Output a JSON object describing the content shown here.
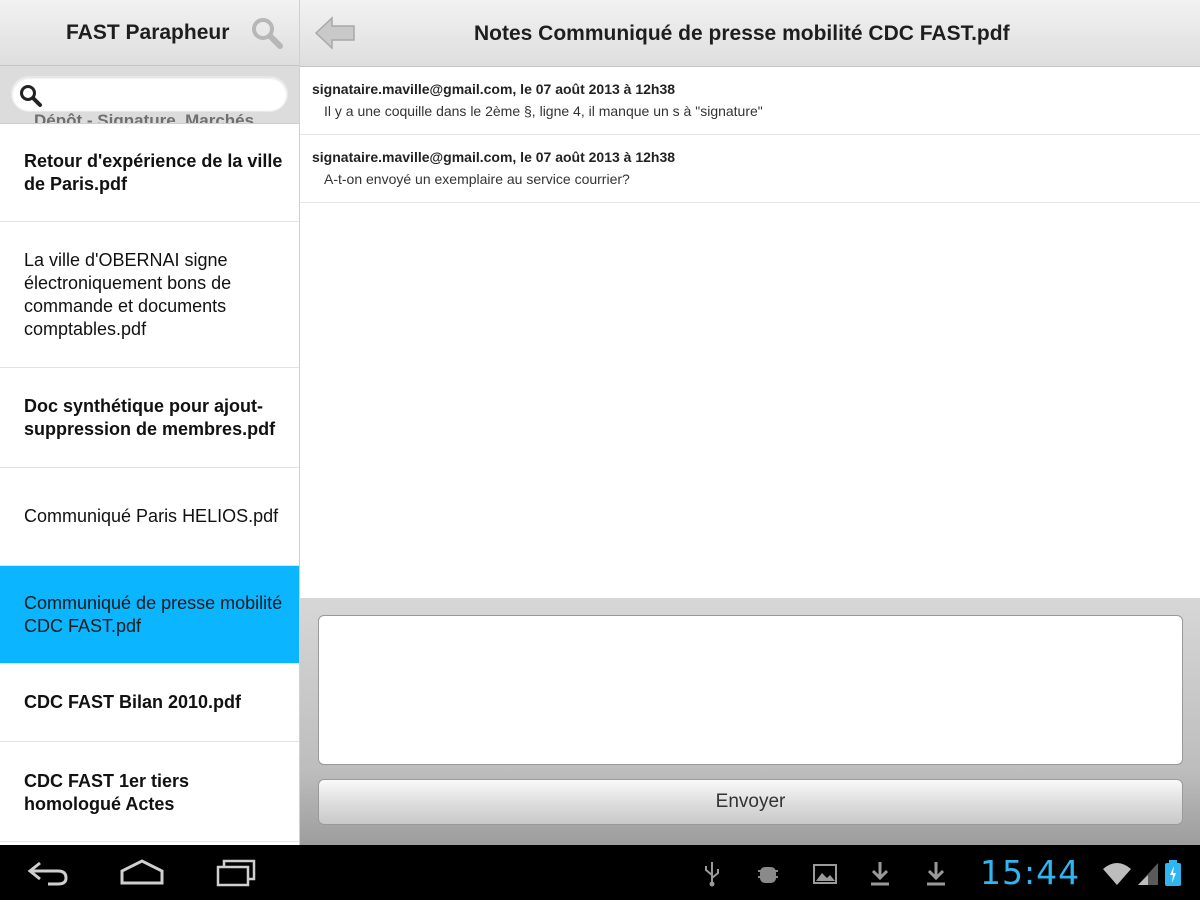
{
  "left_header": {
    "title": "FAST Parapheur"
  },
  "search": {
    "placeholder": "",
    "value": "",
    "peek_text": "Dépôt - Signature, Marchés"
  },
  "documents": [
    {
      "label": "Retour d'expérience de la ville de Paris.pdf",
      "bold": true,
      "selected": false
    },
    {
      "label": "La ville d'OBERNAI signe électroniquement bons de commande et documents comptables.pdf",
      "bold": false,
      "selected": false
    },
    {
      "label": "Doc synthétique pour ajout-suppression de membres.pdf",
      "bold": true,
      "selected": false
    },
    {
      "label": "Communiqué Paris HELIOS.pdf",
      "bold": false,
      "selected": false
    },
    {
      "label": "Communiqué de presse mobilité CDC FAST.pdf",
      "bold": false,
      "selected": true
    },
    {
      "label": "CDC FAST Bilan 2010.pdf",
      "bold": true,
      "selected": false
    },
    {
      "label": "CDC FAST 1er tiers homologué Actes",
      "bold": true,
      "selected": false
    }
  ],
  "right_header": {
    "title": "Notes Communiqué de presse mobilité CDC FAST.pdf"
  },
  "notes": [
    {
      "meta": "signataire.maville@gmail.com, le 07 août 2013 à 12h38",
      "text": "Il y a une coquille dans le 2ème §, ligne 4, il manque un s à \"signature\""
    },
    {
      "meta": "signataire.maville@gmail.com, le 07 août 2013 à 12h38",
      "text": "A-t-on envoyé un exemplaire au service courrier?"
    }
  ],
  "compose": {
    "value": "",
    "send_label": "Envoyer"
  },
  "system_bar": {
    "clock": "15:44"
  },
  "colors": {
    "selected": "#0bb5ff",
    "clock": "#2fb6f0"
  }
}
